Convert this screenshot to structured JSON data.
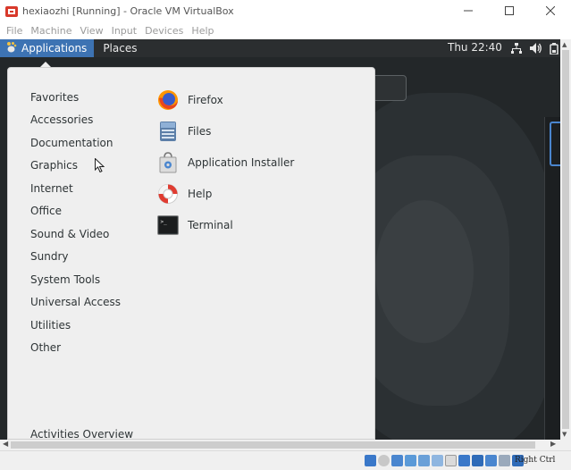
{
  "window": {
    "title": "hexiaozhi  [Running] - Oracle VM VirtualBox",
    "icon": "virtualbox-icon"
  },
  "menubar": {
    "items": [
      "File",
      "Machine",
      "View",
      "Input",
      "Devices",
      "Help"
    ]
  },
  "topbar": {
    "applications_label": "Applications",
    "places_label": "Places",
    "clock": "Thu 22:40",
    "tray_icons": [
      "network-icon",
      "volume-icon",
      "battery-icon"
    ]
  },
  "app_menu": {
    "categories": [
      "Favorites",
      "Accessories",
      "Documentation",
      "Graphics",
      "Internet",
      "Office",
      "Sound & Video",
      "Sundry",
      "System Tools",
      "Universal Access",
      "Utilities",
      "Other"
    ],
    "apps": [
      {
        "label": "Firefox",
        "icon": "firefox-icon"
      },
      {
        "label": "Files",
        "icon": "files-icon"
      },
      {
        "label": "Application Installer",
        "icon": "software-installer-icon"
      },
      {
        "label": "Help",
        "icon": "help-lifebuoy-icon"
      },
      {
        "label": "Terminal",
        "icon": "terminal-icon"
      }
    ],
    "activities_label": "Activities Overview"
  },
  "statusbar": {
    "host_key": "Right Ctrl"
  },
  "colors": {
    "accent": "#3d73b3",
    "desktop_bg": "#232729",
    "menu_bg": "#efefef"
  }
}
